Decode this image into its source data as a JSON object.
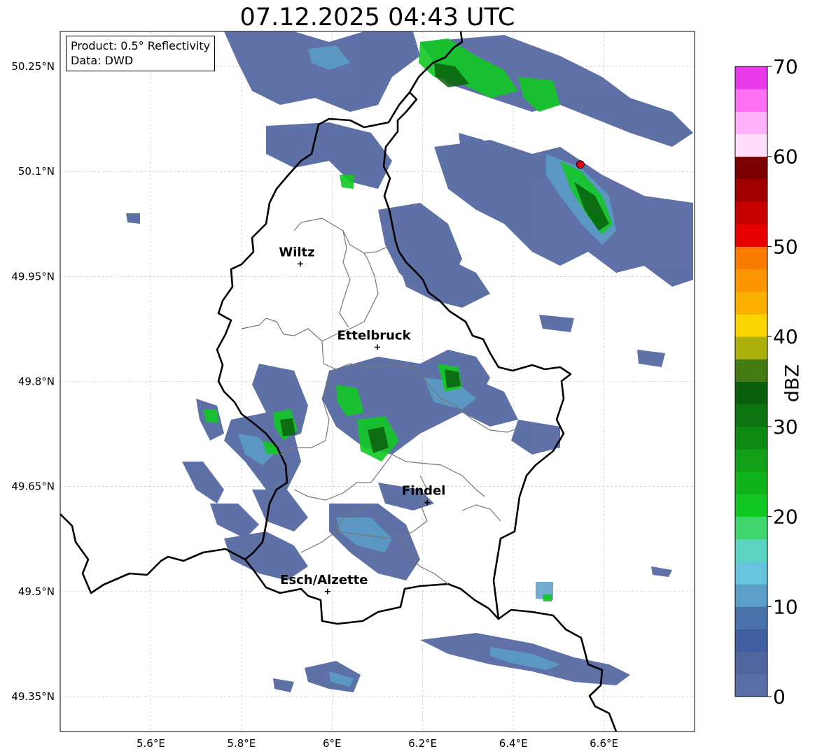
{
  "title": "07.12.2025 04:43 UTC",
  "info": {
    "product": "Product: 0.5° Reflectivity",
    "data": "Data: DWD"
  },
  "axes": {
    "lat_ticks": [
      "50.25°N",
      "50.1°N",
      "49.95°N",
      "49.8°N",
      "49.65°N",
      "49.5°N",
      "49.35°N"
    ],
    "lon_ticks": [
      "5.6°E",
      "5.8°E",
      "6°E",
      "6.2°E",
      "6.4°E",
      "6.6°E"
    ],
    "lat_values": [
      50.25,
      50.1,
      49.95,
      49.8,
      49.65,
      49.5,
      49.35
    ],
    "lon_values": [
      5.6,
      5.8,
      6.0,
      6.2,
      6.4,
      6.6
    ],
    "lat_range": [
      49.3,
      50.3
    ],
    "lon_range": [
      5.4,
      6.8
    ],
    "grid": true
  },
  "cities": [
    {
      "name": "Wiltz",
      "lon": 5.93,
      "lat": 49.968
    },
    {
      "name": "Ettelbruck",
      "lon": 6.1,
      "lat": 49.849
    },
    {
      "name": "Findel",
      "lon": 6.21,
      "lat": 49.627
    },
    {
      "name": "Esch/Alzette",
      "lon": 5.99,
      "lat": 49.5
    }
  ],
  "marker": {
    "name": "radar-site",
    "lon": 6.548,
    "lat": 50.11,
    "color": "#e8001a"
  },
  "colorbar": {
    "label": "dBZ",
    "min": 0,
    "max": 70,
    "tick_labels": [
      "0",
      "10",
      "20",
      "30",
      "40",
      "50",
      "60",
      "70"
    ],
    "colors": [
      "#5a6ea8",
      "#51659f",
      "#425ea2",
      "#4a72ab",
      "#5b9ec8",
      "#66c4dc",
      "#5bd4c4",
      "#3fd66e",
      "#12c825",
      "#10b31c",
      "#109f16",
      "#0e8a12",
      "#0c7410",
      "#0a5f0d",
      "#457a10",
      "#abb10a",
      "#fad400",
      "#fbb000",
      "#fb9600",
      "#fb7a00",
      "#e80000",
      "#c80000",
      "#a00000",
      "#7c0000",
      "#ffddfb",
      "#ffb2fa",
      "#ff70f5",
      "#e83aea"
    ]
  }
}
